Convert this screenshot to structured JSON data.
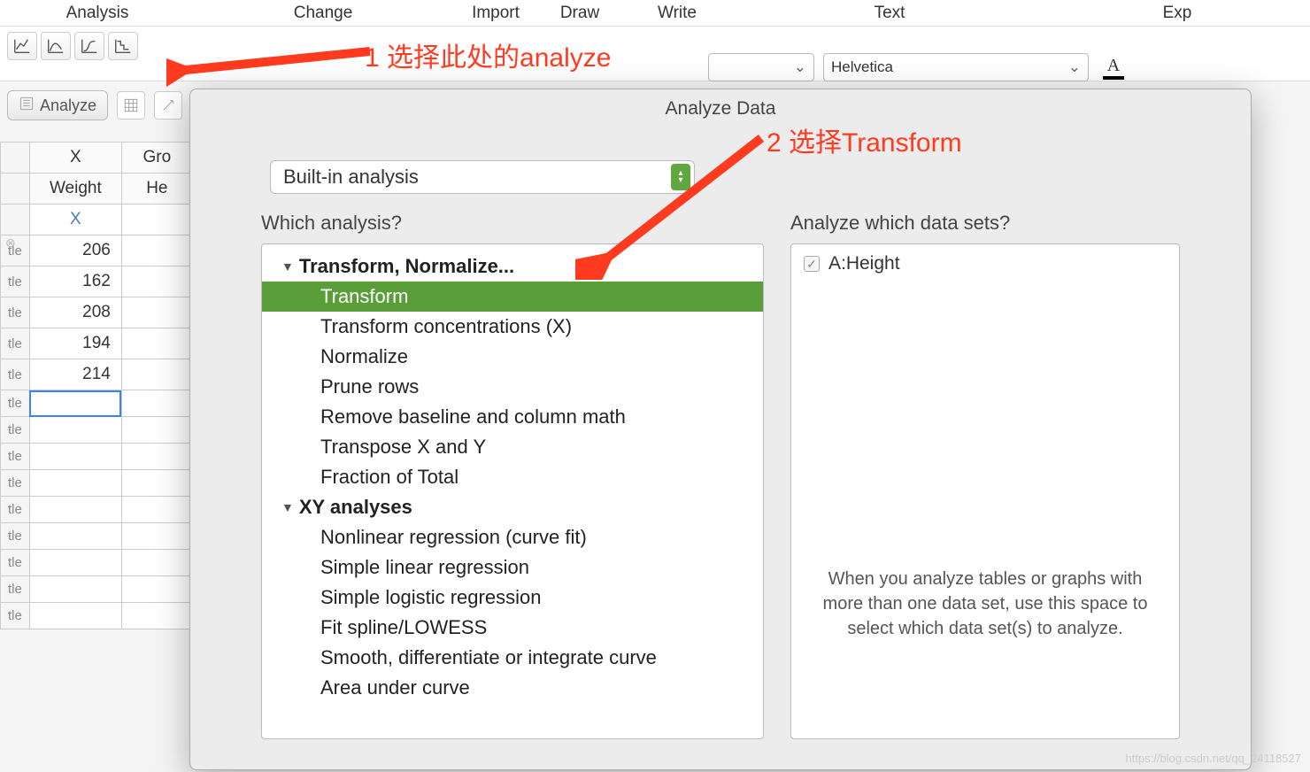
{
  "menu": {
    "analysis": "Analysis",
    "change": "Change",
    "import": "Import",
    "draw": "Draw",
    "write": "Write",
    "text": "Text",
    "exp": "Exp"
  },
  "toolbar": {
    "font": "Helvetica"
  },
  "analyze_button": "Analyze",
  "table": {
    "headers": {
      "x": "X",
      "gro": "Gro"
    },
    "subheaders": {
      "weight": "Weight",
      "he": "He"
    },
    "x_label": "X",
    "row_label": "tle",
    "values": [
      "206",
      "162",
      "208",
      "194",
      "214"
    ]
  },
  "dialog": {
    "title": "Analyze Data",
    "builtin": "Built-in analysis",
    "which": "Which analysis?",
    "which_sets": "Analyze which data sets?",
    "group1": "Transform, Normalize...",
    "items1": [
      "Transform",
      "Transform concentrations (X)",
      "Normalize",
      "Prune rows",
      "Remove baseline and column math",
      "Transpose X and Y",
      "Fraction of Total"
    ],
    "group2": "XY analyses",
    "items2": [
      "Nonlinear regression (curve fit)",
      "Simple linear regression",
      "Simple logistic regression",
      "Fit spline/LOWESS",
      "Smooth, differentiate or integrate curve",
      "Area under curve"
    ],
    "dataset": "A:Height",
    "help": "When you analyze tables or graphs with more than one data set, use this space to select which data set(s) to analyze."
  },
  "annotations": {
    "a1": "1 选择此处的analyze",
    "a2": "2 选择Transform"
  },
  "watermark": "https://blog.csdn.net/qq_24118527"
}
